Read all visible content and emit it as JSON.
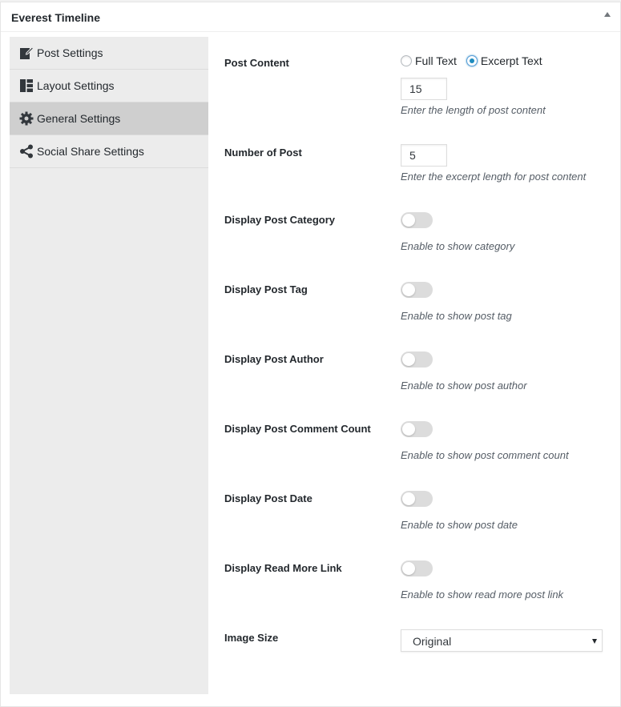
{
  "panel": {
    "title": "Everest Timeline"
  },
  "sidebar": {
    "items": [
      {
        "label": "Post Settings",
        "icon": "edit-icon",
        "active": false
      },
      {
        "label": "Layout Settings",
        "icon": "layout-icon",
        "active": false
      },
      {
        "label": "General Settings",
        "icon": "gear-icon",
        "active": true
      },
      {
        "label": "Social Share Settings",
        "icon": "share-icon",
        "active": false
      }
    ]
  },
  "settings": {
    "post_content": {
      "label": "Post Content",
      "options": [
        "Full Text",
        "Excerpt Text"
      ],
      "selected": "Excerpt Text",
      "length_value": "15",
      "hint": "Enter the length of post content"
    },
    "number_of_post": {
      "label": "Number of Post",
      "value": "5",
      "hint": "Enter the excerpt length for post content"
    },
    "toggles": [
      {
        "label": "Display Post Category",
        "hint": "Enable to show category",
        "enabled": false
      },
      {
        "label": "Display Post Tag",
        "hint": "Enable to show post tag",
        "enabled": false
      },
      {
        "label": "Display Post Author",
        "hint": "Enable to show post author",
        "enabled": false
      },
      {
        "label": "Display Post Comment Count",
        "hint": "Enable to show post comment count",
        "enabled": false
      },
      {
        "label": "Display Post Date",
        "hint": "Enable to show post date",
        "enabled": false
      },
      {
        "label": "Display Read More Link",
        "hint": "Enable to show read more post link",
        "enabled": false
      }
    ],
    "image_size": {
      "label": "Image Size",
      "value": "Original"
    }
  },
  "colors": {
    "accent": "#1e8cbe",
    "sidebar_bg": "#ececec",
    "sidebar_active": "#cfcfcf",
    "switch_off": "#dcdcdc"
  }
}
